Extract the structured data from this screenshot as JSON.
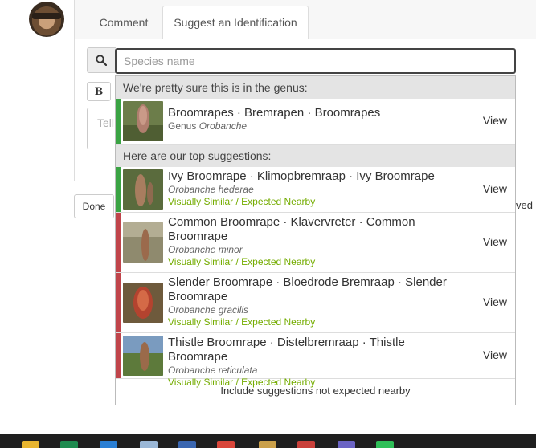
{
  "tabs": [
    {
      "label": "Comment",
      "active": false
    },
    {
      "label": "Suggest an Identification",
      "active": true
    }
  ],
  "search": {
    "placeholder": "Species name",
    "value": ""
  },
  "editor": {
    "bold_label": "B",
    "textarea_placeholder": "Tell"
  },
  "done_label": "Done",
  "right_edge_text": "ved",
  "dropdown": {
    "genus_heading": "We're pretty sure this is in the genus:",
    "genus": {
      "names": "Broomrapes · Bremrapen · Broomrapes",
      "rank": "Genus",
      "scientific": "Orobanche",
      "view": "View",
      "bar_color": "#3aa343"
    },
    "top_heading": "Here are our top suggestions:",
    "suggestions": [
      {
        "names": "Ivy Broomrape · Klimopbremraap · Ivy Broomrape",
        "scientific": "Orobanche hederae",
        "reason": "Visually Similar / Expected Nearby",
        "view": "View",
        "bar_color": "#3aa343"
      },
      {
        "names": "Common Broomrape · Klavervreter · Common Broomrape",
        "scientific": "Orobanche minor",
        "reason": "Visually Similar / Expected Nearby",
        "view": "View",
        "bar_color": "#c0444a"
      },
      {
        "names": "Slender Broomrape · Bloedrode Bremraap · Slender Broomrape",
        "scientific": "Orobanche gracilis",
        "reason": "Visually Similar / Expected Nearby",
        "view": "View",
        "bar_color": "#c0444a"
      },
      {
        "names": "Thistle Broomrape · Distelbremraap · Thistle Broomrape",
        "scientific": "Orobanche reticulata",
        "reason": "Visually Similar / Expected Nearby",
        "view": "View",
        "bar_color": "#c0444a"
      }
    ],
    "footer_link": "Include suggestions not expected nearby"
  },
  "colors": {
    "accent_green": "#74ac00",
    "bar_green": "#3aa343",
    "bar_red": "#c0444a"
  },
  "icons": {
    "search": "search-icon"
  }
}
